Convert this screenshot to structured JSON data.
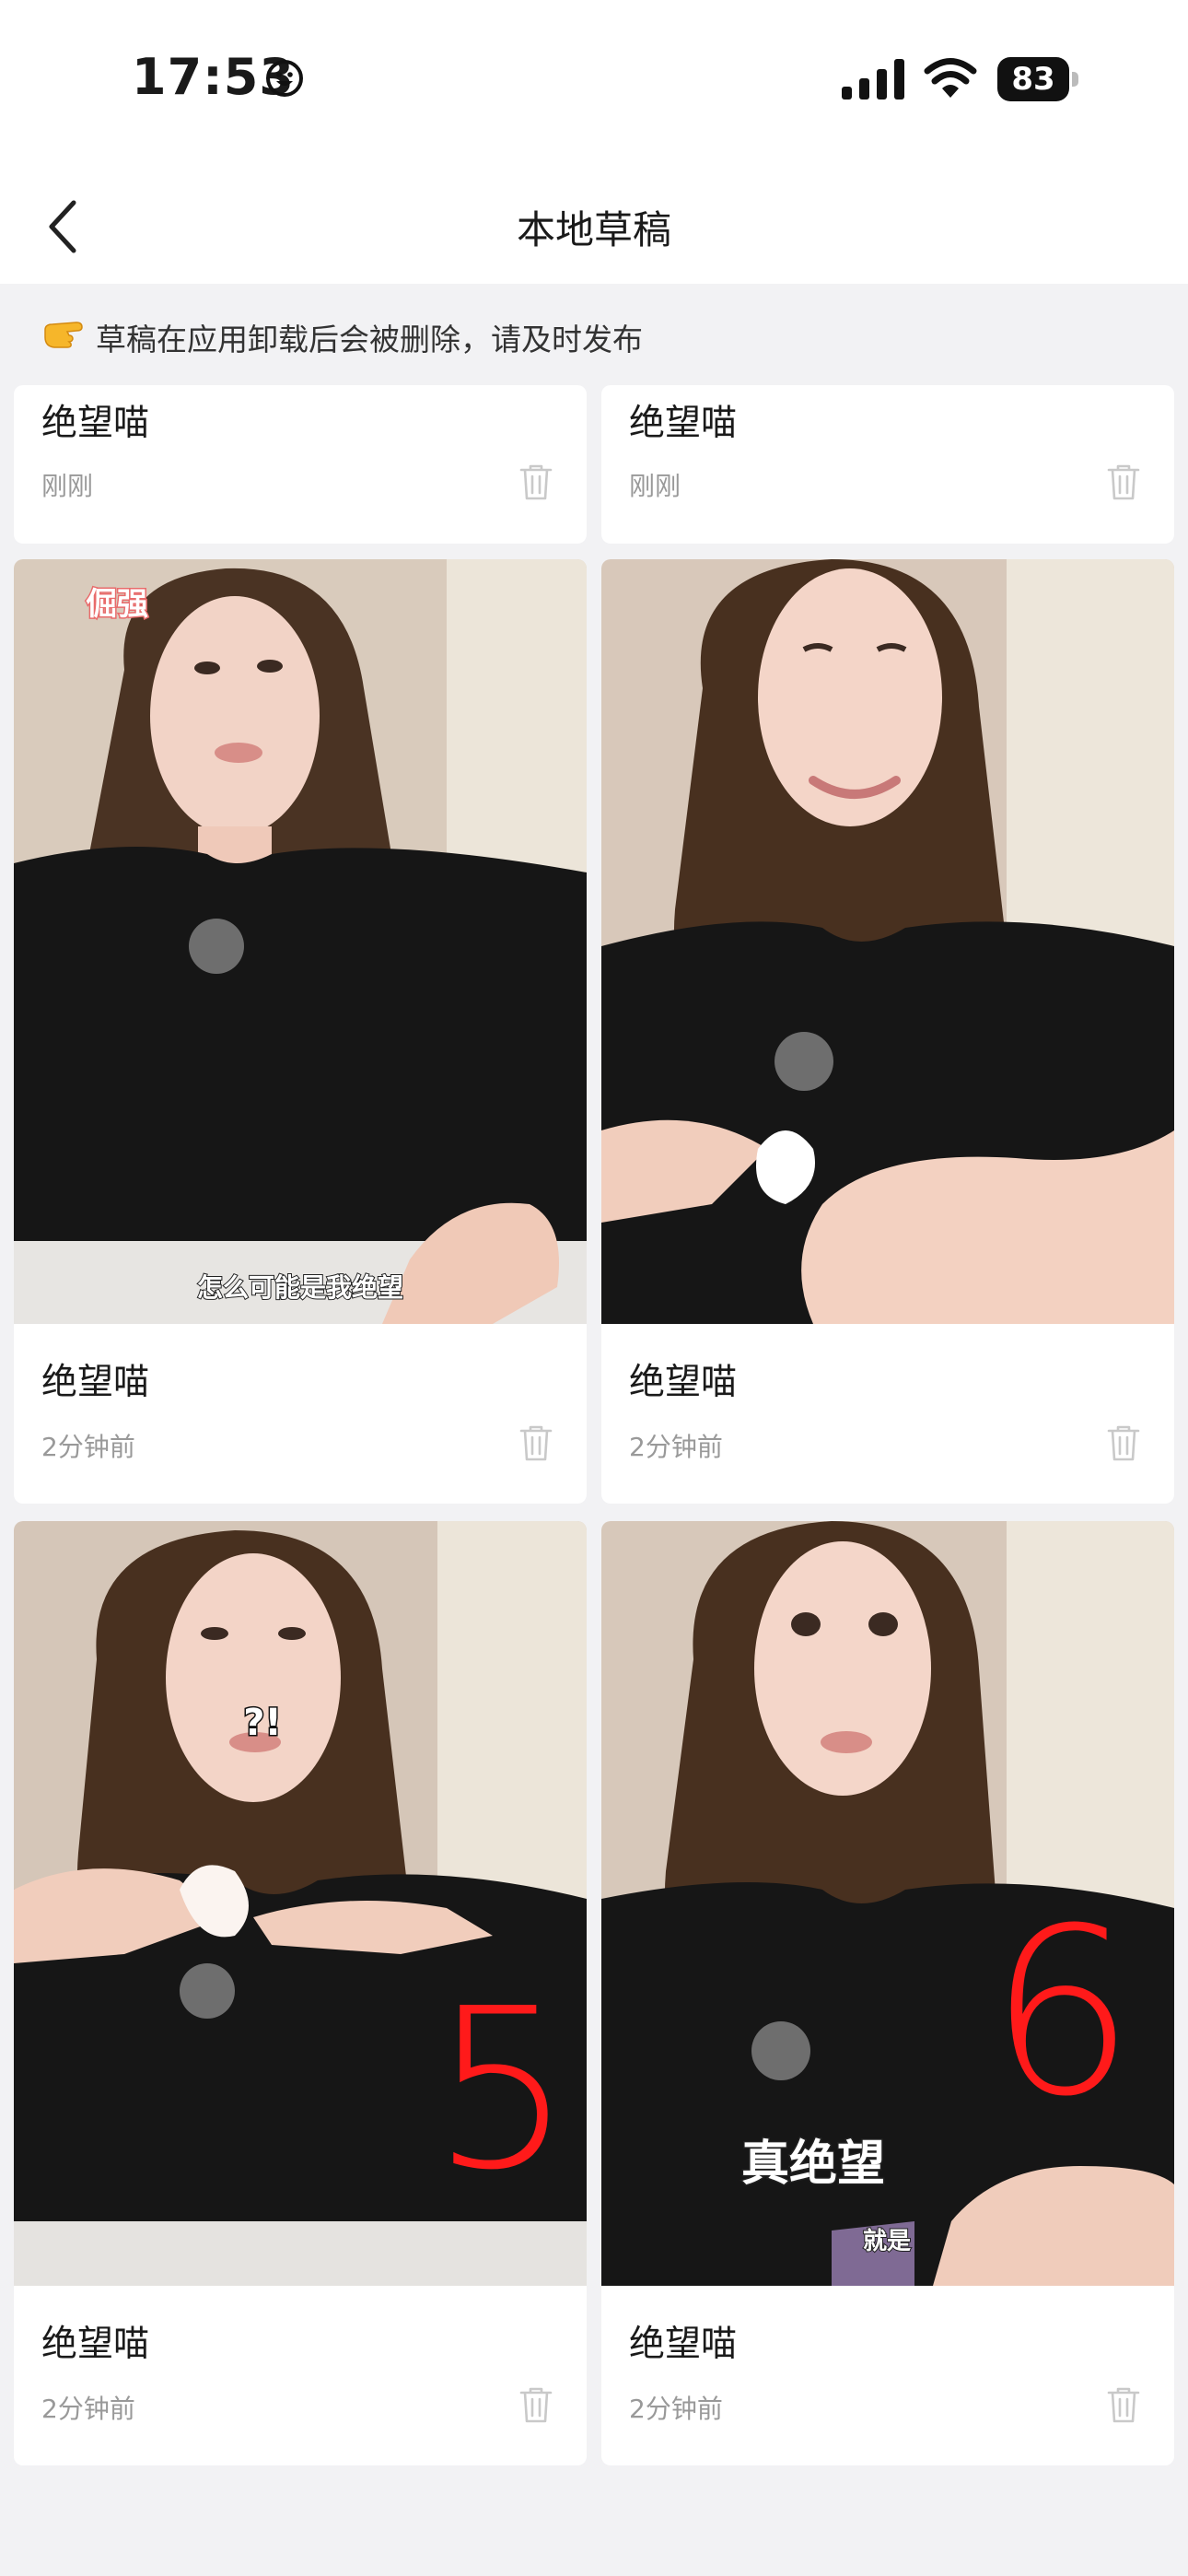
{
  "status_bar": {
    "time": "17:53",
    "battery": "83"
  },
  "nav": {
    "title": "本地草稿"
  },
  "notice": {
    "text": "草稿在应用卸载后会被删除，请及时发布"
  },
  "drafts": [
    {
      "title": "绝望喵",
      "time": "刚刚"
    },
    {
      "title": "绝望喵",
      "time": "刚刚"
    },
    {
      "title": "绝望喵",
      "time": "2分钟前",
      "overlay": [
        "倔强",
        "怎么可能是我绝望"
      ]
    },
    {
      "title": "绝望喵",
      "time": "2分钟前"
    },
    {
      "title": "绝望喵",
      "time": "2分钟前",
      "overlay": [
        "?!",
        "5"
      ]
    },
    {
      "title": "绝望喵",
      "time": "2分钟前",
      "overlay": [
        "真绝望",
        "就是",
        "6"
      ]
    }
  ]
}
